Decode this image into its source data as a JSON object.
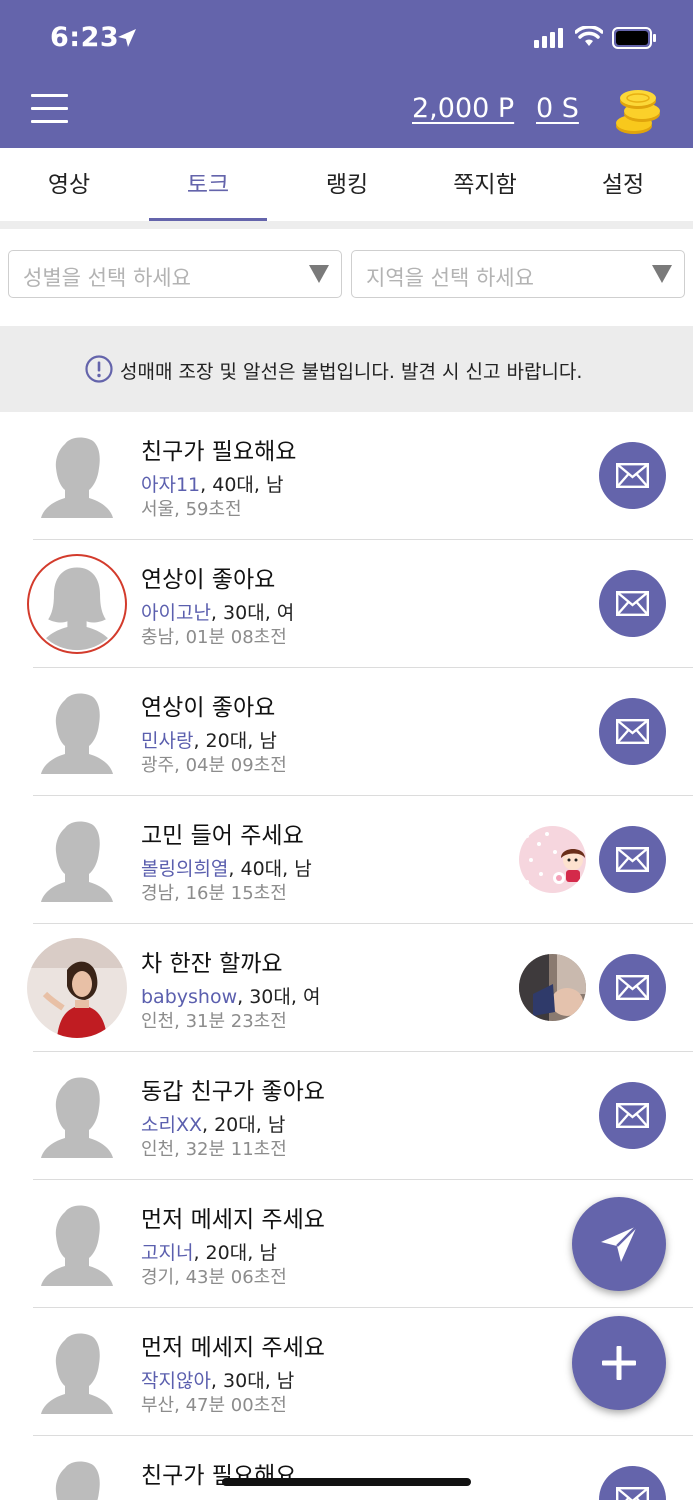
{
  "status_bar": {
    "time": "6:23"
  },
  "header": {
    "points": "2,000 P",
    "seeds": "0 S"
  },
  "tabs": [
    "영상",
    "토크",
    "랭킹",
    "쪽지함",
    "설정"
  ],
  "active_tab": "토크",
  "filters": {
    "gender_placeholder": "성별을 선택 하세요",
    "region_placeholder": "지역을 선택 하세요"
  },
  "notice": "성매매 조장 및 알선은 불법입니다. 발견 시 신고 바랍니다.",
  "posts": [
    {
      "title": "친구가 필요해요",
      "nick": "아자11",
      "age": "40대",
      "gender": "남",
      "region": "서울",
      "time": "59초전",
      "avatar": "male-silhouette"
    },
    {
      "title": "연상이 좋아요",
      "nick": "아이고난",
      "age": "30대",
      "gender": "여",
      "region": "충남",
      "time": "01분 08초전",
      "avatar": "female-silhouette"
    },
    {
      "title": "연상이 좋아요",
      "nick": "민사랑",
      "age": "20대",
      "gender": "남",
      "region": "광주",
      "time": "04분 09초전",
      "avatar": "male-silhouette"
    },
    {
      "title": "고민 들어 주세요",
      "nick": "볼링의희열",
      "age": "40대",
      "gender": "남",
      "region": "경남",
      "time": "16분 15초전",
      "avatar": "male-silhouette"
    },
    {
      "title": "차 한잔 할까요",
      "nick": "babyshow",
      "age": "30대",
      "gender": "여",
      "region": "인천",
      "time": "31분 23초전",
      "avatar": "photo"
    },
    {
      "title": "동갑 친구가 좋아요",
      "nick": "소리XX",
      "age": "20대",
      "gender": "남",
      "region": "인천",
      "time": "32분 11초전",
      "avatar": "male-silhouette"
    },
    {
      "title": "먼저 메세지 주세요",
      "nick": "고지너",
      "age": "20대",
      "gender": "남",
      "region": "경기",
      "time": "43분 06초전",
      "avatar": "male-silhouette"
    },
    {
      "title": "먼저 메세지 주세요",
      "nick": "작지않아",
      "age": "30대",
      "gender": "남",
      "region": "부산",
      "time": "47분 00초전",
      "avatar": "male-silhouette"
    },
    {
      "title": "친구가 필요해요",
      "nick": "",
      "age": "",
      "gender": "",
      "region": "",
      "time": "",
      "avatar": "male-silhouette"
    }
  ],
  "icons": {
    "menu": "hamburger-icon",
    "coins": "coins-icon",
    "notice": "exclamation-circle-icon",
    "mail": "envelope-icon",
    "fab_send": "paper-plane-icon",
    "fab_add": "plus-icon"
  },
  "colors": {
    "primary": "#6464ab",
    "nickname": "#5b5fae",
    "ring": "#d33b2c"
  }
}
